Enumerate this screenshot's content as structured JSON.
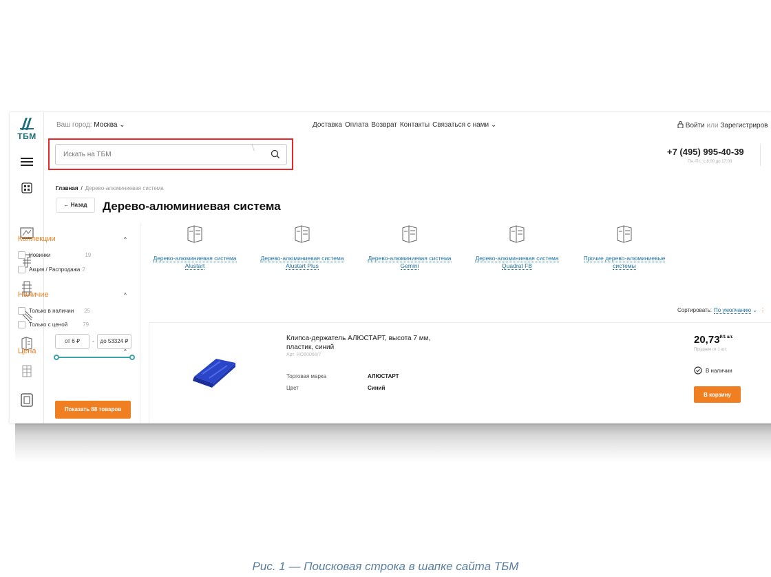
{
  "topbar": {
    "city_prefix": "Ваш город:",
    "city": "Москва",
    "nav": [
      "Доставка",
      "Оплата",
      "Возврат",
      "Контакты",
      "Связаться с нами"
    ],
    "login": "Войти",
    "or": "или",
    "register": "Зарегистриров"
  },
  "search": {
    "placeholder": "Искать на ТБМ"
  },
  "contact": {
    "phone": "+7 (495) 995-40-39",
    "hours": "Пн.-Пт.: с 8:00 до 17:00"
  },
  "logo": {
    "text": "ТБМ"
  },
  "breadcrumb": {
    "home": "Главная",
    "separator": "/",
    "current": "Дерево-алюминиевая система"
  },
  "page": {
    "back_label": "Назад",
    "title": "Дерево-алюминиевая система"
  },
  "filters": {
    "collections": {
      "title": "Коллекции",
      "options": [
        {
          "label": "Новинки",
          "count": "19"
        },
        {
          "label": "Акция / Распродажа",
          "count": "2"
        }
      ]
    },
    "availability": {
      "title": "Наличие",
      "options": [
        {
          "label": "Только в наличии",
          "count": "25"
        },
        {
          "label": "Только с ценой",
          "count": "79"
        }
      ]
    },
    "price": {
      "title": "Цена",
      "from": "от 6 ₽",
      "dash": "-",
      "to": "до 53324 ₽"
    },
    "show_button": "Показать 88 товаров"
  },
  "categories": [
    {
      "line1": "Дерево-алюминиевая система",
      "line2": "Alustart"
    },
    {
      "line1": "Дерево-алюминиевая система",
      "line2": "Alustart Plus"
    },
    {
      "line1": "Дерево-алюминиевая система",
      "line2": "Gemini"
    },
    {
      "line1": "Дерево-алюминиевая система",
      "line2": "Quadrat FB"
    },
    {
      "line1": "Прочие дерево-алюминиевые",
      "line2": "системы"
    }
  ],
  "sort": {
    "label": "Сортировать:",
    "value": "По умолчанию"
  },
  "product": {
    "name": "Клипса-держатель АЛЮСТАРТ, высота 7 мм, пластик, синий",
    "article": "Арт. RO50066/7",
    "attrs": [
      {
        "label": "Торговая марка",
        "value": "АЛЮСТАРТ"
      },
      {
        "label": "Цвет",
        "value": "Синий"
      }
    ],
    "price": "20,73",
    "price_unit": "₽/1 шт.",
    "min_sale": "Продаем от 1 шт.",
    "stock": "В наличии",
    "cart_button": "В корзину"
  },
  "caption": "Рис. 1 — Поисковая строка в шапке сайта ТБМ",
  "colors": {
    "accent": "#f07f22",
    "link": "#1a6f9c",
    "highlight": "#e8262b",
    "brand": "#1f6f7a"
  }
}
